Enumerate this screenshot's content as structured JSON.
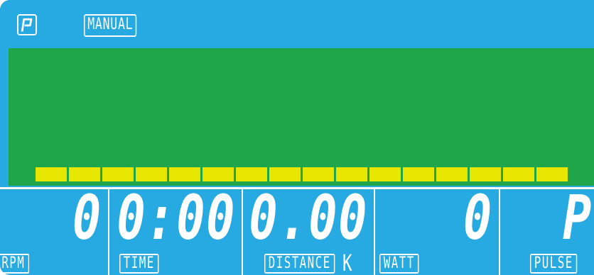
{
  "header": {
    "program_icon": "program-p-icon",
    "mode_label": "MANUAL"
  },
  "profile": {
    "bar_count": 16,
    "bar_color": "#e6e600",
    "background_color": "#1fa64a"
  },
  "panels": {
    "rpm": {
      "value": "0",
      "label": "RPM"
    },
    "time": {
      "value": "0:00",
      "label": "TIME"
    },
    "distance": {
      "value": "0.00",
      "label": "DISTANCE",
      "unit": "K"
    },
    "watt": {
      "value": "0",
      "label": "WATT"
    },
    "pulse": {
      "value": "P",
      "label": "PULSE"
    }
  },
  "colors": {
    "screen": "#27a9e1",
    "text": "#ffffff"
  }
}
